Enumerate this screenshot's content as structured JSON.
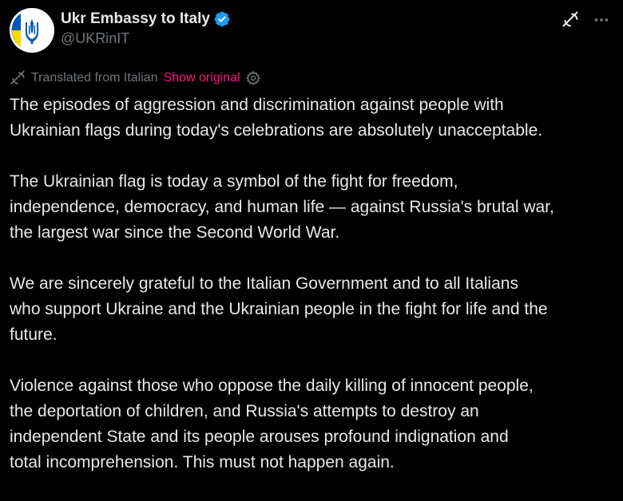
{
  "author": {
    "display_name": "Ukr Embassy to Italy",
    "handle": "@UKRinIT",
    "verified": true,
    "avatar_icon": "ukraine-trident-icon"
  },
  "header_actions": {
    "grok_icon": "grok-icon",
    "more_icon": "more-horizontal-icon"
  },
  "translation": {
    "icon": "translate-icon",
    "label": "Translated from Italian",
    "show_original": "Show original",
    "settings_icon": "gear-icon"
  },
  "tweet": {
    "paragraphs": [
      [
        "The episodes of aggression and discrimination against people with",
        "Ukrainian flags during today's celebrations are absolutely unacceptable."
      ],
      [
        "The Ukrainian flag is today a symbol of the fight for freedom,",
        "independence, democracy, and human life — against Russia's brutal war,",
        "the largest war since the Second World War."
      ],
      [
        "We are sincerely grateful to the Italian Government and to all Italians",
        "who support Ukraine and the Ukrainian people in the fight for life and the",
        "future."
      ],
      [
        "Violence against those who oppose the daily killing of innocent people,",
        "the deportation of children, and Russia's attempts to destroy an",
        "independent State and its people arouses profound indignation and",
        "total incomprehension. This must not happen again."
      ]
    ]
  },
  "colors": {
    "background": "#000000",
    "text_primary": "#e7e9ea",
    "text_secondary": "#71767b",
    "accent_pink": "#f91880",
    "verified_blue": "#1d9bf0",
    "ukraine_blue": "#0057b7",
    "ukraine_yellow": "#ffd700"
  }
}
